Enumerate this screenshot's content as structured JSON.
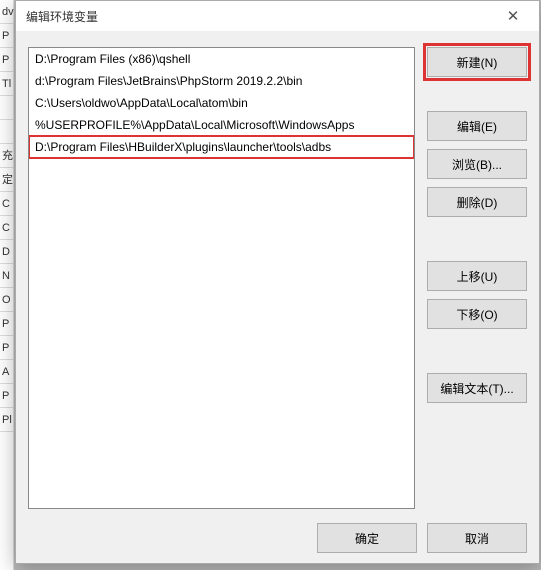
{
  "dialog": {
    "title": "编辑环境变量",
    "close_symbol": "✕"
  },
  "list": {
    "items": [
      "D:\\Program Files (x86)\\qshell",
      "d:\\Program Files\\JetBrains\\PhpStorm 2019.2.2\\bin",
      "C:\\Users\\oldwo\\AppData\\Local\\atom\\bin",
      "%USERPROFILE%\\AppData\\Local\\Microsoft\\WindowsApps",
      "D:\\Program Files\\HBuilderX\\plugins\\launcher\\tools\\adbs"
    ],
    "highlighted_index": 4
  },
  "buttons": {
    "new": "新建(N)",
    "edit": "编辑(E)",
    "browse": "浏览(B)...",
    "delete": "删除(D)",
    "move_up": "上移(U)",
    "move_down": "下移(O)",
    "edit_text": "编辑文本(T)...",
    "ok": "确定",
    "cancel": "取消"
  },
  "bg_labels": [
    "dv",
    "P",
    "P",
    "Tl",
    "",
    "",
    "充",
    "定",
    "C",
    "C",
    "D",
    "N",
    "O",
    "P",
    "P",
    "A",
    "P",
    "Pl"
  ]
}
